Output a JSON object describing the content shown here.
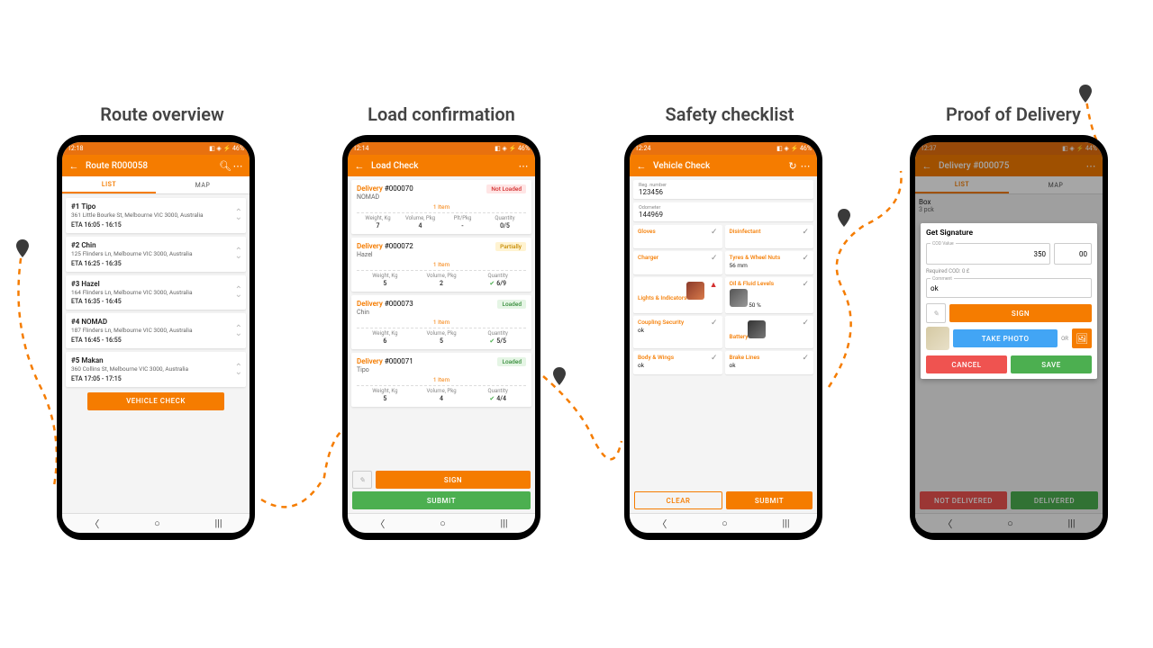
{
  "captions": {
    "p1": "Route overview",
    "p2": "Load confirmation",
    "p3": "Safety checklist",
    "p4": "Proof of Delivery"
  },
  "status": {
    "time1": "12:18",
    "time2": "12:14",
    "time3": "12:24",
    "time4": "12:37",
    "battery": "46%"
  },
  "route": {
    "title": "Route R000058",
    "tabs": {
      "list": "LIST",
      "map": "MAP"
    },
    "stops": [
      {
        "idx": "#1",
        "name": "Tipo",
        "addr": "361 Little Bourke St, Melbourne VIC 3000, Australia",
        "eta": "ETA 16:05 - 16:15"
      },
      {
        "idx": "#2",
        "name": "Chin",
        "addr": "125 Flinders Ln, Melbourne VIC 3000, Australia",
        "eta": "ETA 16:25 - 16:35"
      },
      {
        "idx": "#3",
        "name": "Hazel",
        "addr": "164 Flinders Ln, Melbourne VIC 3000, Australia",
        "eta": "ETA 16:35 - 16:45"
      },
      {
        "idx": "#4",
        "name": "NOMAD",
        "addr": "187 Flinders Ln, Melbourne VIC 3000, Australia",
        "eta": "ETA 16:45 - 16:55"
      },
      {
        "idx": "#5",
        "name": "Makan",
        "addr": "360 Collins St, Melbourne VIC 3000, Australia",
        "eta": "ETA 17:05 - 17:15"
      }
    ],
    "vehicle_check_btn": "VEHICLE CHECK"
  },
  "load": {
    "title": "Load Check",
    "statuses": {
      "not_loaded": "Not Loaded",
      "partially": "Partially",
      "loaded": "Loaded"
    },
    "labels": {
      "delivery": "Delivery",
      "weight": "Weight, Kg",
      "volume": "Volume, Pkg",
      "plt": "Plt/Pkg",
      "qty": "Quantity",
      "item1": "1 Item"
    },
    "deliveries": [
      {
        "num": "#000070",
        "cust": "NOMAD",
        "status": "not_loaded",
        "weight": "7",
        "volume": "4",
        "plt": "-",
        "qty": "0/5"
      },
      {
        "num": "#000072",
        "cust": "Hazel",
        "status": "partially",
        "weight": "5",
        "volume": "2",
        "qty": "6/9"
      },
      {
        "num": "#000073",
        "cust": "Chin",
        "status": "loaded",
        "weight": "6",
        "volume": "5",
        "qty": "5/5"
      },
      {
        "num": "#000071",
        "cust": "Tipo",
        "status": "loaded",
        "weight": "5",
        "volume": "4",
        "qty": "4/4"
      }
    ],
    "sign_btn": "SIGN",
    "submit_btn": "SUBMIT"
  },
  "safety": {
    "title": "Vehicle Check",
    "reg_label": "Reg. number",
    "reg_val": "123456",
    "odo_label": "Odometer",
    "odo_val": "144969",
    "items": {
      "gloves": "Gloves",
      "disinfectant": "Disinfectant",
      "charger": "Charger",
      "tyres": "Tyres & Wheel Nuts",
      "tyres_val": "56 mm",
      "lights": "Lights & Indicators",
      "oil": "Oil & Fluid Levels",
      "oil_val": "50 %",
      "coupling": "Coupling Security",
      "coupling_val": "ok",
      "battery": "Battery",
      "body": "Body & Wings",
      "body_val": "ok",
      "brakes": "Brake Lines",
      "brakes_val": "ok"
    },
    "clear_btn": "CLEAR",
    "submit_btn": "SUBMIT"
  },
  "pod": {
    "title": "Delivery #000075",
    "tabs": {
      "list": "LIST",
      "map": "MAP"
    },
    "box_label": "Box",
    "box_qty": "3 pck",
    "dialog_title": "Get Signature",
    "cod_label": "COD Value",
    "cod_val": "350",
    "cod_dec": "00",
    "required_cod": "Required COD: 0 £",
    "comment_label": "Comment",
    "comment_val": "ok",
    "sign_btn": "SIGN",
    "photo_btn": "TAKE PHOTO",
    "or_label": "OR",
    "cancel_btn": "CANCEL",
    "save_btn": "SAVE",
    "not_delivered_btn": "NOT DELIVERED",
    "delivered_btn": "DELIVERED"
  }
}
